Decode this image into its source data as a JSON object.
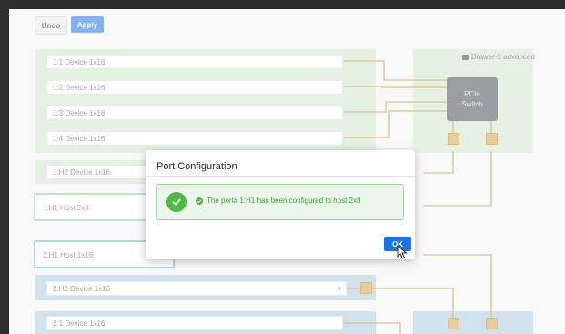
{
  "toolbar": {
    "undo_label": "Undo",
    "apply_label": "Apply"
  },
  "drawer": {
    "label": "Drawer-1 advanced"
  },
  "switch": {
    "line1": "PCIe",
    "line2": "Switch"
  },
  "rows": [
    {
      "label": "1:1 Device 1x16"
    },
    {
      "label": "1:2 Device 1x16"
    },
    {
      "label": "1:3 Device 1x16"
    },
    {
      "label": "1:4 Device 1x16"
    },
    {
      "label": "1:H2 Device 1x16"
    },
    {
      "label": "1:H1 Host 2x8"
    },
    {
      "label": "2:H1 Host 1x16"
    },
    {
      "label": "2:H2 Device 1x16"
    },
    {
      "label": "2:1 Device 1x16"
    }
  ],
  "modal": {
    "title": "Port Configuration",
    "message": "The port# 1:H1 has been configured to host 2x8",
    "ok_label": "OK"
  },
  "colors": {
    "accent": "#1a73e8",
    "success": "#50b748",
    "error_text": "#d23a3a",
    "wire": "#c08a2d"
  }
}
